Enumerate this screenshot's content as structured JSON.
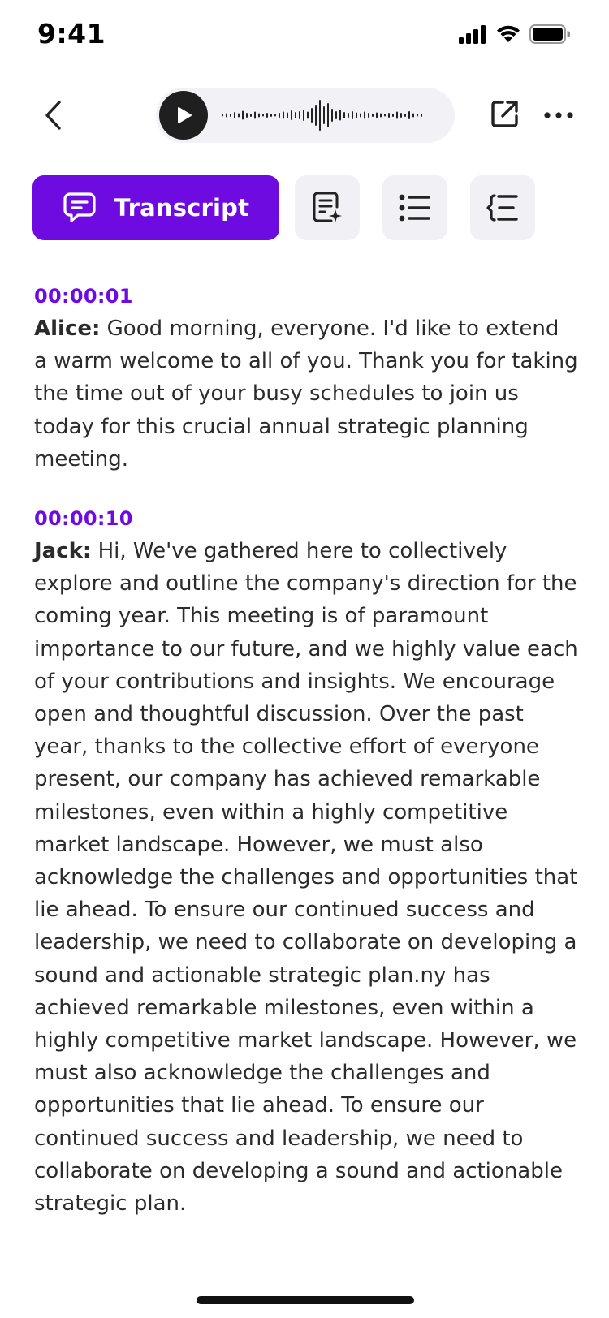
{
  "status_bar": {
    "time": "9:41"
  },
  "header": {
    "back_icon": "chevron-left-icon",
    "player": {
      "play_icon": "play-icon",
      "waveform": "waveform"
    },
    "share_icon": "external-share-icon",
    "more_icon": "more-horizontal-icon"
  },
  "tabs": {
    "transcript_label": "Transcript",
    "active": "transcript",
    "others": [
      "ai-notes-icon",
      "list-icon",
      "outline-icon"
    ]
  },
  "colors": {
    "accent": "#6E0BE0",
    "tab_bg": "#F1F1F5",
    "text": "#2B2B2B"
  },
  "transcript": [
    {
      "time": "00:00:01",
      "speaker": "Alice:",
      "text": " Good morning, everyone. I'd like to extend a warm welcome to all of you. Thank you for taking the time out of your busy schedules to join us today for this crucial annual strategic planning meeting."
    },
    {
      "time": "00:00:10",
      "speaker": "Jack:",
      "text": " Hi, We've gathered here to collectively explore and outline the company's direction for the coming year. This meeting is of paramount importance to our future, and we highly value each of your contributions and insights. We encourage open and thoughtful discussion. Over the past year, thanks to the collective effort of everyone present, our company has achieved remarkable milestones, even within a highly competitive market landscape. However, we must also acknowledge the challenges and opportunities that lie ahead. To ensure our continued success and leadership, we need to collaborate on developing a sound and actionable strategic plan.ny has achieved remarkable milestones, even within a highly competitive market landscape. However, we must also acknowledge the challenges and opportunities that lie ahead. To ensure our continued success and leadership, we need to collaborate on developing a sound and actionable strategic plan."
    }
  ]
}
